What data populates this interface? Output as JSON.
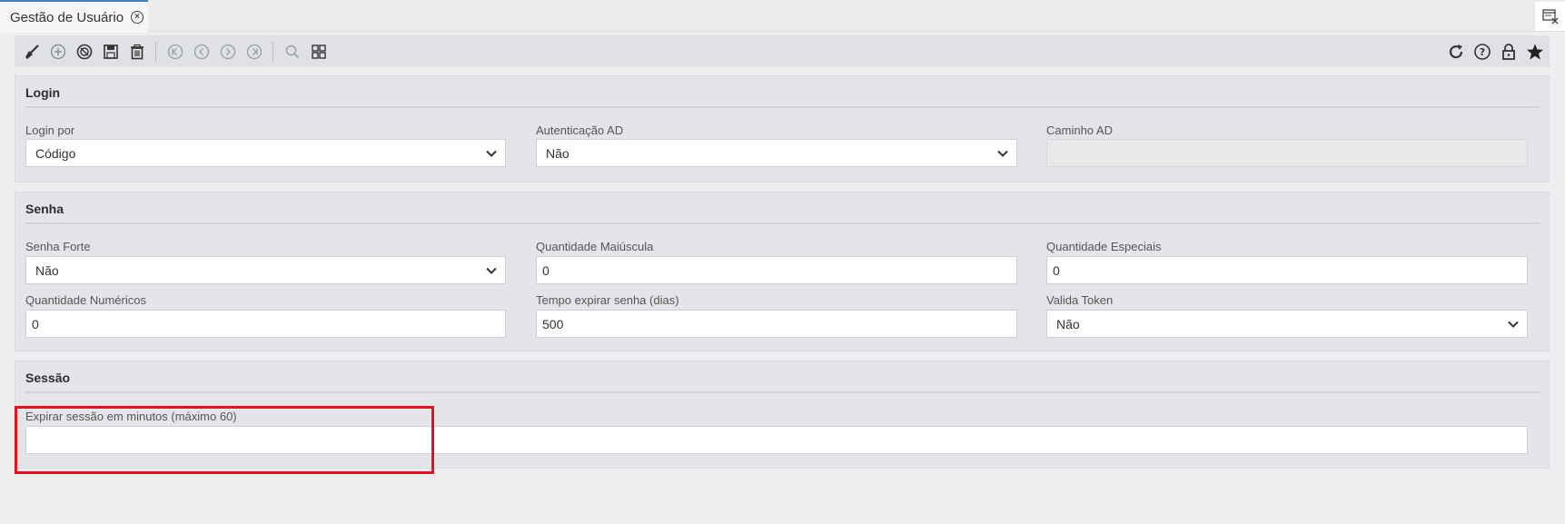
{
  "tab": {
    "title": "Gestão de Usuário"
  },
  "icons": {
    "tab_close": "close-circle-icon",
    "corner": "window-close-icon",
    "toolbar_left": [
      "broom-icon",
      "add-circle-icon",
      "cancel-circle-icon",
      "save-icon",
      "trash-icon",
      "first-icon",
      "previous-icon",
      "next-icon",
      "last-icon",
      "search-icon",
      "grid-icon"
    ],
    "toolbar_right": [
      "refresh-icon",
      "help-icon",
      "lock-icon",
      "star-icon"
    ]
  },
  "sections": {
    "login": {
      "title": "Login",
      "login_por_label": "Login por",
      "login_por_value": "Código",
      "autenticacao_label": "Autenticação AD",
      "autenticacao_value": "Não",
      "caminho_label": "Caminho AD",
      "caminho_value": ""
    },
    "senha": {
      "title": "Senha",
      "senha_forte_label": "Senha Forte",
      "senha_forte_value": "Não",
      "qtd_maiuscula_label": "Quantidade Maiúscula",
      "qtd_maiuscula_value": "0",
      "qtd_especiais_label": "Quantidade Especiais",
      "qtd_especiais_value": "0",
      "qtd_numericos_label": "Quantidade Numéricos",
      "qtd_numericos_value": "0",
      "tempo_expirar_label": "Tempo expirar senha (dias)",
      "tempo_expirar_value": "500",
      "valida_token_label": "Valida Token",
      "valida_token_value": "Não"
    },
    "sessao": {
      "title": "Sessão",
      "expirar_label": "Expirar sessão em minutos (máximo 60)",
      "expirar_value": ""
    }
  },
  "colors": {
    "accent": "#3d7fc6",
    "highlight": "#e8101a"
  }
}
